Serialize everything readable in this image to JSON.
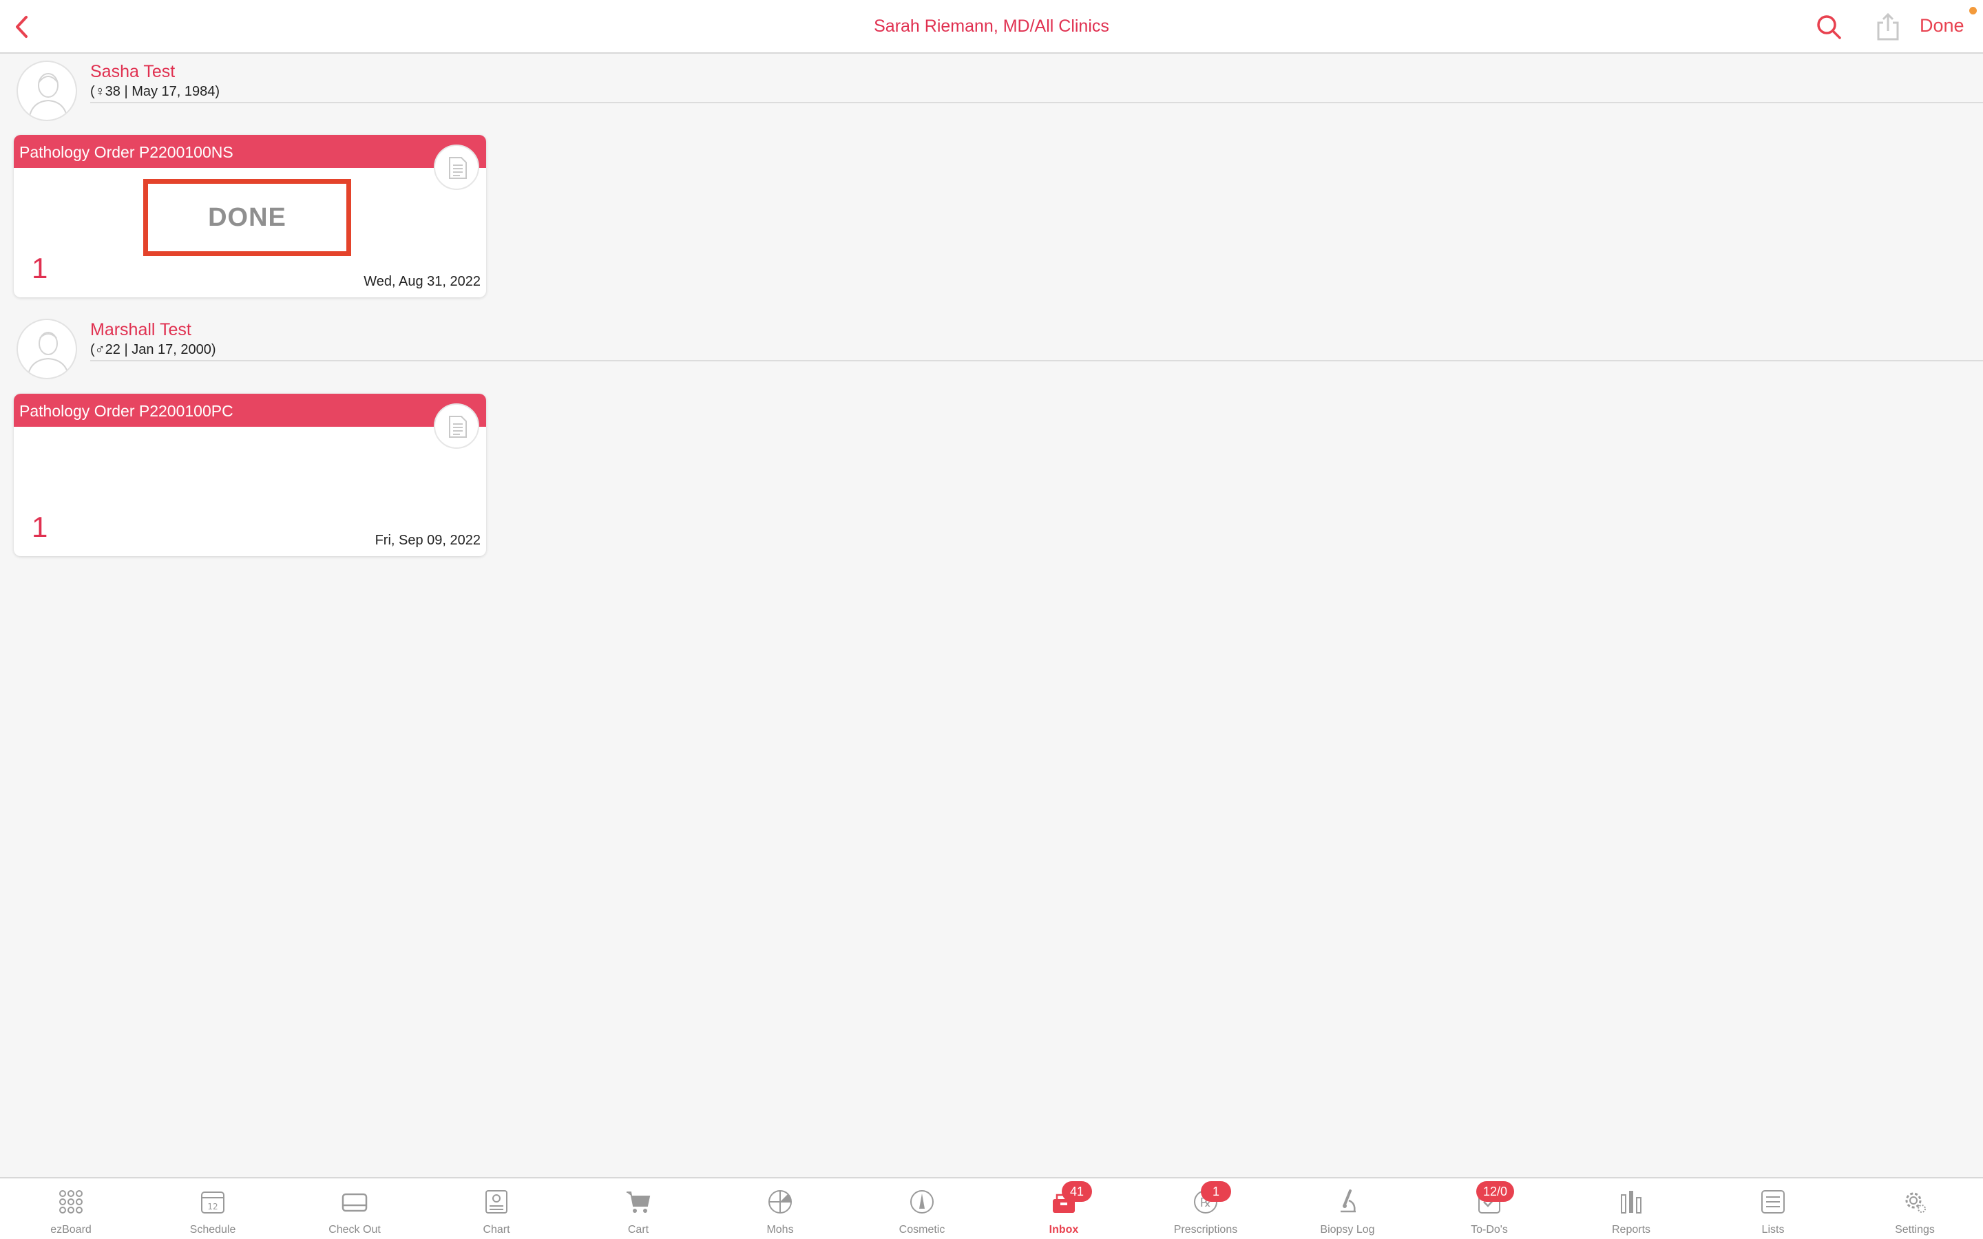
{
  "nav": {
    "title": "Sarah Riemann, MD/All Clinics",
    "done_label": "Done",
    "accent": "#e8414f",
    "back_icon": "chevron-left-icon",
    "search_icon": "search-icon",
    "share_icon": "share-icon"
  },
  "patients": [
    {
      "name": "Sasha Test",
      "info": "(♀38 | May 17, 1984)",
      "order": {
        "title": "Pathology Order P2200100NS",
        "stamp": "DONE",
        "count": "1",
        "date": "Wed, Aug 31, 2022"
      }
    },
    {
      "name": "Marshall Test",
      "info": "(♂22 | Jan 17, 2000)",
      "order": {
        "title": "Pathology Order P2200100PC",
        "stamp": "",
        "count": "1",
        "date": "Fri, Sep 09, 2022"
      }
    }
  ],
  "tabs": [
    {
      "label": "ezBoard",
      "icon": "grid-icon",
      "badge": ""
    },
    {
      "label": "Schedule",
      "icon": "calendar-icon",
      "badge": ""
    },
    {
      "label": "Check Out",
      "icon": "card-icon",
      "badge": ""
    },
    {
      "label": "Chart",
      "icon": "chart-icon",
      "badge": ""
    },
    {
      "label": "Cart",
      "icon": "cart-icon",
      "badge": ""
    },
    {
      "label": "Mohs",
      "icon": "mohs-icon",
      "badge": ""
    },
    {
      "label": "Cosmetic",
      "icon": "cosmetic-icon",
      "badge": ""
    },
    {
      "label": "Inbox",
      "icon": "inbox-icon",
      "badge": "41",
      "active": true
    },
    {
      "label": "Prescriptions",
      "icon": "rx-icon",
      "badge": "1"
    },
    {
      "label": "Biopsy Log",
      "icon": "microscope-icon",
      "badge": ""
    },
    {
      "label": "To-Do's",
      "icon": "todo-icon",
      "badge": "12/0"
    },
    {
      "label": "Reports",
      "icon": "reports-icon",
      "badge": ""
    },
    {
      "label": "Lists",
      "icon": "list-icon",
      "badge": ""
    },
    {
      "label": "Settings",
      "icon": "gear-icon",
      "badge": ""
    }
  ]
}
